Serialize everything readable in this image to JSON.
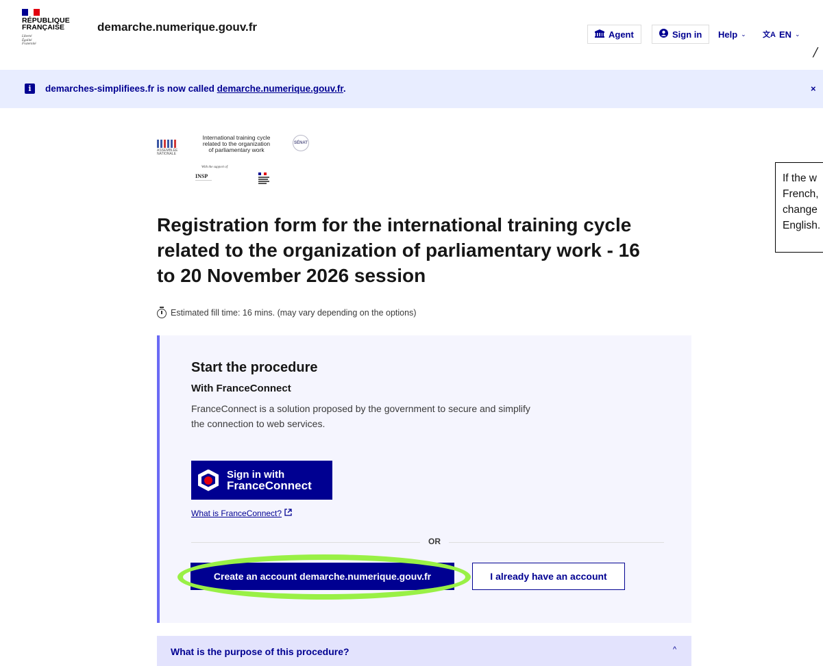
{
  "header": {
    "republic_lines": [
      "RÉPUBLIQUE",
      "FRANÇAISE"
    ],
    "motto_lines": [
      "Liberté",
      "Égalité",
      "Fraternité"
    ],
    "site_name": "demarche.numerique.gouv.fr",
    "agent_label": "Agent",
    "signin_label": "Sign in",
    "help_label": "Help",
    "lang_label": "EN"
  },
  "notice": {
    "text_before": "demarches-simplifiees.fr is now called ",
    "link_text": "demarche.numerique.gouv.fr",
    "text_after": ".",
    "close_symbol": "×"
  },
  "logos": {
    "assemblee_lines": [
      "ASSEMBLÉE",
      "NATIONALE"
    ],
    "cycle_text_lines": [
      "International training cycle",
      "related to the organization",
      "of parliamentary work"
    ],
    "senat_text": "SÉNAT",
    "support_text": "With the support of",
    "insp_text": "INSP"
  },
  "page": {
    "title": "Registration form for the international training cycle related to the organization of parliamentary work - 16 to 20 November 2026 session",
    "fill_time": "Estimated fill time: 16 mins. (may vary depending on the options)"
  },
  "annotation": {
    "lines": [
      "If the w",
      "French,",
      "change",
      "English."
    ]
  },
  "procedure": {
    "heading": "Start the procedure",
    "subheading": "With FranceConnect",
    "description": "FranceConnect is a solution proposed by the government to secure and simplify the connection to web services.",
    "fc_button_line1": "Sign in with",
    "fc_button_line2": "FranceConnect",
    "fc_link": "What is FranceConnect?",
    "or_text": "OR",
    "create_account": "Create an account demarche.numerique.gouv.fr",
    "have_account": "I already have an account"
  },
  "accordion": {
    "label": "What is the purpose of this procedure?",
    "chevron": "^"
  },
  "colors": {
    "brand_blue": "#000091",
    "notice_bg": "#e8edff",
    "card_bg": "#f5f5fe",
    "card_accent": "#6a6af4",
    "highlight": "#99f046",
    "accordion_bg": "#e3e3fd"
  }
}
